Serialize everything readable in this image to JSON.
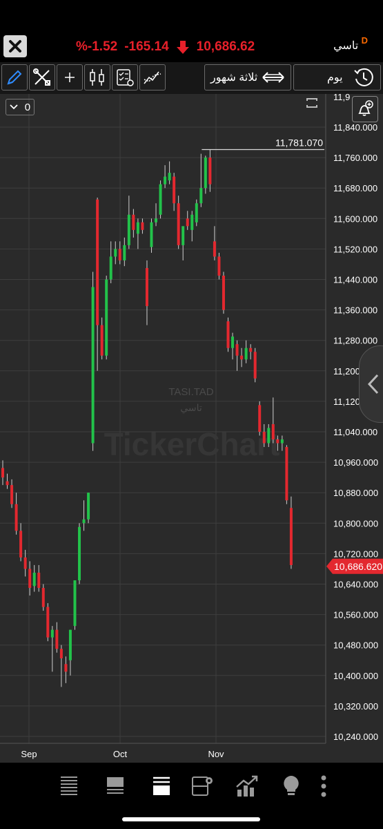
{
  "header": {
    "percent_change": "%-1.52",
    "change": "-165.14",
    "last_price": "10,686.62",
    "symbol_name": "تاسي",
    "symbol_flag": "D"
  },
  "toolbar": {
    "period_label": "ثلاثة شهور",
    "interval_label": "يوم"
  },
  "chart": {
    "counter_value": "0",
    "watermark_symbol": "TASI.TAD",
    "watermark_name": "تاسي",
    "watermark_brand": "TickerChart"
  },
  "chart_data": {
    "type": "candlestick",
    "high_marker_label": "11,781.070",
    "last_price_label": "10,686.620",
    "y_ticks": [
      "11,9",
      "11,840.000",
      "11,760.000",
      "11,680.000",
      "11,600.000",
      "11,520.000",
      "11,440.000",
      "11,360.000",
      "11,280.000",
      "11,200.000",
      "11,120.000",
      "11,040.000",
      "10,960.000",
      "10,880.000",
      "10,800.000",
      "10,720.000",
      "10,640.000",
      "10,560.000",
      "10,480.000",
      "10,400.000",
      "10,320.000",
      "10,240.000"
    ],
    "x_ticks": [
      "Sep",
      "Oct",
      "Nov"
    ],
    "ylim": [
      10230,
      11925
    ],
    "colors": {
      "up": "#22c24a",
      "down": "#e3282f",
      "grid": "#3e3e3e",
      "axis_text": "#ffffff",
      "marker": "#d9d9d9",
      "last_price_badge": "#e3282f"
    },
    "candles": [
      {
        "o": 10945,
        "h": 10965,
        "l": 10900,
        "c": 10920
      },
      {
        "o": 10910,
        "h": 10930,
        "l": 10890,
        "c": 10900
      },
      {
        "o": 10900,
        "h": 10915,
        "l": 10840,
        "c": 10850
      },
      {
        "o": 10850,
        "h": 10880,
        "l": 10770,
        "c": 10780
      },
      {
        "o": 10780,
        "h": 10800,
        "l": 10700,
        "c": 10710
      },
      {
        "o": 10710,
        "h": 10730,
        "l": 10660,
        "c": 10680
      },
      {
        "o": 10680,
        "h": 10700,
        "l": 10610,
        "c": 10630
      },
      {
        "o": 10635,
        "h": 10690,
        "l": 10620,
        "c": 10670
      },
      {
        "o": 10670,
        "h": 10690,
        "l": 10620,
        "c": 10630
      },
      {
        "o": 10630,
        "h": 10640,
        "l": 10570,
        "c": 10580
      },
      {
        "o": 10580,
        "h": 10590,
        "l": 10490,
        "c": 10500
      },
      {
        "o": 10500,
        "h": 10530,
        "l": 10410,
        "c": 10520
      },
      {
        "o": 10520,
        "h": 10540,
        "l": 10460,
        "c": 10470
      },
      {
        "o": 10470,
        "h": 10480,
        "l": 10370,
        "c": 10445
      },
      {
        "o": 10430,
        "h": 10450,
        "l": 10380,
        "c": 10410
      },
      {
        "o": 10440,
        "h": 10520,
        "l": 10400,
        "c": 10520
      },
      {
        "o": 10530,
        "h": 10650,
        "l": 10520,
        "c": 10650
      },
      {
        "o": 10650,
        "h": 10800,
        "l": 10640,
        "c": 10790
      },
      {
        "o": 10800,
        "h": 10860,
        "l": 10780,
        "c": 10810
      },
      {
        "o": 10810,
        "h": 10880,
        "l": 10800,
        "c": 10880
      },
      {
        "o": 11010,
        "h": 11460,
        "l": 10990,
        "c": 11420
      },
      {
        "o": 11650,
        "h": 11655,
        "l": 11200,
        "c": 11320
      },
      {
        "o": 11320,
        "h": 11340,
        "l": 11230,
        "c": 11240
      },
      {
        "o": 11240,
        "h": 11450,
        "l": 11230,
        "c": 11440
      },
      {
        "o": 11440,
        "h": 11540,
        "l": 11430,
        "c": 11500
      },
      {
        "o": 11500,
        "h": 11540,
        "l": 11480,
        "c": 11520
      },
      {
        "o": 11520,
        "h": 11540,
        "l": 11480,
        "c": 11490
      },
      {
        "o": 11490,
        "h": 11550,
        "l": 11475,
        "c": 11530
      },
      {
        "o": 11530,
        "h": 11660,
        "l": 11520,
        "c": 11610
      },
      {
        "o": 11610,
        "h": 11625,
        "l": 11550,
        "c": 11570
      },
      {
        "o": 11560,
        "h": 11600,
        "l": 11520,
        "c": 11590
      },
      {
        "o": 11590,
        "h": 11600,
        "l": 11560,
        "c": 11570
      },
      {
        "o": 11470,
        "h": 11490,
        "l": 11320,
        "c": 11370
      },
      {
        "o": 11525,
        "h": 11600,
        "l": 11510,
        "c": 11590
      },
      {
        "o": 11590,
        "h": 11640,
        "l": 11580,
        "c": 11600
      },
      {
        "o": 11610,
        "h": 11700,
        "l": 11600,
        "c": 11690
      },
      {
        "o": 11690,
        "h": 11740,
        "l": 11680,
        "c": 11710
      },
      {
        "o": 11700,
        "h": 11750,
        "l": 11690,
        "c": 11720
      },
      {
        "o": 11710,
        "h": 11720,
        "l": 11620,
        "c": 11640
      },
      {
        "o": 11640,
        "h": 11660,
        "l": 11520,
        "c": 11530
      },
      {
        "o": 11530,
        "h": 11570,
        "l": 11490,
        "c": 11580
      },
      {
        "o": 11600,
        "h": 11620,
        "l": 11570,
        "c": 11580
      },
      {
        "o": 11570,
        "h": 11620,
        "l": 11540,
        "c": 11610
      },
      {
        "o": 11590,
        "h": 11650,
        "l": 11580,
        "c": 11640
      },
      {
        "o": 11640,
        "h": 11770,
        "l": 11630,
        "c": 11680
      },
      {
        "o": 11680,
        "h": 11765,
        "l": 11665,
        "c": 11760
      },
      {
        "o": 11760,
        "h": 11781,
        "l": 11670,
        "c": 11690
      },
      {
        "o": 11540,
        "h": 11580,
        "l": 11490,
        "c": 11500
      },
      {
        "o": 11500,
        "h": 11510,
        "l": 11440,
        "c": 11450
      },
      {
        "o": 11450,
        "h": 11460,
        "l": 11350,
        "c": 11360
      },
      {
        "o": 11330,
        "h": 11340,
        "l": 11250,
        "c": 11260
      },
      {
        "o": 11260,
        "h": 11300,
        "l": 11230,
        "c": 11290
      },
      {
        "o": 11270,
        "h": 11280,
        "l": 11200,
        "c": 11240
      },
      {
        "o": 11240,
        "h": 11260,
        "l": 11210,
        "c": 11230
      },
      {
        "o": 11230,
        "h": 11280,
        "l": 11220,
        "c": 11260
      },
      {
        "o": 11260,
        "h": 11270,
        "l": 11230,
        "c": 11250
      },
      {
        "o": 11250,
        "h": 11260,
        "l": 11170,
        "c": 11180
      },
      {
        "o": 11110,
        "h": 11120,
        "l": 11030,
        "c": 11040
      },
      {
        "o": 11040,
        "h": 11060,
        "l": 11000,
        "c": 11010
      },
      {
        "o": 11010,
        "h": 11060,
        "l": 11000,
        "c": 11050
      },
      {
        "o": 11060,
        "h": 11130,
        "l": 11010,
        "c": 11020
      },
      {
        "o": 11020,
        "h": 11030,
        "l": 10990,
        "c": 11010
      },
      {
        "o": 11010,
        "h": 11030,
        "l": 10990,
        "c": 11020
      },
      {
        "o": 11000,
        "h": 11005,
        "l": 10850,
        "c": 10860
      },
      {
        "o": 10840,
        "h": 10870,
        "l": 10680,
        "c": 10690
      }
    ]
  },
  "bottom_nav": {
    "items": [
      "list-lines-icon",
      "list-dense-icon",
      "list-active-icon",
      "portfolio-gear-icon",
      "chart-up-icon",
      "bulb-icon",
      "more-dots-icon"
    ]
  }
}
